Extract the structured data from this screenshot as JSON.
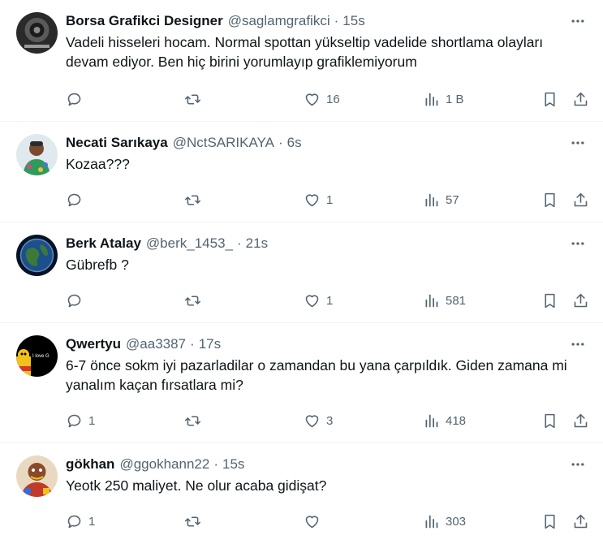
{
  "tweets": [
    {
      "name": "Borsa Grafikci Designer",
      "handle": "@saglamgrafikci",
      "sep": "·",
      "time": "15s",
      "text": "Vadeli hisseleri hocam. Normal spottan yükseltip vadelide shortlama olayları devam ediyor. Ben hiç birini yorumlayıp grafiklemiyorum",
      "replies": "",
      "retweets": "",
      "likes": "16",
      "views": "1 B"
    },
    {
      "name": "Necati Sarıkaya",
      "handle": "@NctSARIKAYA",
      "sep": "·",
      "time": "6s",
      "text": "Kozaa???",
      "replies": "",
      "retweets": "",
      "likes": "1",
      "views": "57"
    },
    {
      "name": "Berk Atalay",
      "handle": "@berk_1453_",
      "sep": "·",
      "time": "21s",
      "text": "Gübrefb ?",
      "replies": "",
      "retweets": "",
      "likes": "1",
      "views": "581"
    },
    {
      "name": "Qwertyu",
      "handle": "@aa3387",
      "sep": "·",
      "time": "17s",
      "text": "6-7 önce sokm iyi pazarladilar o zamandan bu yana çarpıldık. Giden zamana mi yanalım kaçan fırsatlara mi?",
      "avatar_text": "I love G",
      "replies": "1",
      "retweets": "",
      "likes": "3",
      "views": "418"
    },
    {
      "name": "gökhan",
      "handle": "@ggokhann22",
      "sep": "·",
      "time": "15s",
      "text": "Yeotk 250 maliyet. Ne olur acaba gidişat?",
      "replies": "1",
      "retweets": "",
      "likes": "",
      "views": "303"
    }
  ],
  "colors": {
    "text": "#0f1419",
    "secondary": "#536471",
    "divider": "#eff3f4"
  },
  "icons": [
    "reply-icon",
    "retweet-icon",
    "like-icon",
    "views-icon",
    "bookmark-icon",
    "share-icon",
    "more-icon"
  ]
}
